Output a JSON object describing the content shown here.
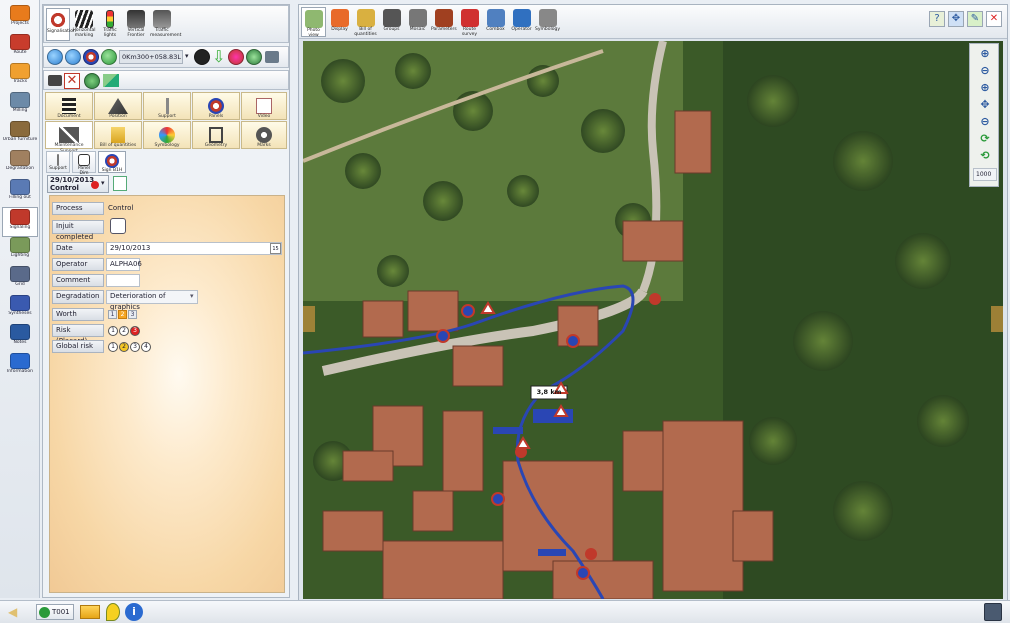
{
  "leftnav": {
    "items": [
      {
        "label": "Projects",
        "icon": "projects-icon",
        "color": "#e87b1c"
      },
      {
        "label": "Route",
        "icon": "route-icon",
        "color": "#c83c2c"
      },
      {
        "label": "Tracks",
        "icon": "tracks-icon",
        "color": "#f0a030"
      },
      {
        "label": "Milling",
        "icon": "milling-icon",
        "color": "#6c8aa8"
      },
      {
        "label": "Urban furniture",
        "icon": "urban-furniture-icon",
        "color": "#8a6a3c"
      },
      {
        "label": "Degradation",
        "icon": "degradation-icon",
        "color": "#a08060"
      },
      {
        "label": "Filling out",
        "icon": "filling-out-icon",
        "color": "#5a7ab4"
      },
      {
        "label": "Signaling",
        "icon": "signaling-icon",
        "color": "#c0392b"
      },
      {
        "label": "Lighting",
        "icon": "lighting-icon",
        "color": "#7a9a5a"
      },
      {
        "label": "Grid",
        "icon": "grid-icon",
        "color": "#5a6a8a"
      },
      {
        "label": "Syntheses",
        "icon": "syntheses-icon",
        "color": "#3a5ab0"
      },
      {
        "label": "Notes",
        "icon": "notes-icon",
        "color": "#2a5aa0"
      },
      {
        "label": "Information",
        "icon": "information-icon",
        "color": "#2a6ad0"
      }
    ]
  },
  "panel": {
    "top_tabs": [
      {
        "label": "Signalisation",
        "color": "#c0392b"
      },
      {
        "label": "Horizontal marking",
        "color": "#333333"
      },
      {
        "label": "Traffic lights",
        "color": "#e0b020"
      },
      {
        "label": "Vertical Frontier",
        "color": "#444444"
      },
      {
        "label": "Traffic measurement",
        "color": "#666666"
      }
    ],
    "pr_value": "0Km300+058.83L",
    "big_buttons_row1": [
      {
        "label": "Document"
      },
      {
        "label": "Position"
      },
      {
        "label": "Support"
      },
      {
        "label": "Panels"
      },
      {
        "label": "Video"
      }
    ],
    "big_buttons_row2": [
      {
        "label": "Maintenance Support"
      },
      {
        "label": "Bill of quantities"
      },
      {
        "label": "Symbology"
      },
      {
        "label": "Geometry"
      },
      {
        "label": "Marks"
      }
    ],
    "small_tabs": [
      {
        "label": "Support"
      },
      {
        "label": "Panel Dim"
      },
      {
        "label": "Sign B1H"
      }
    ],
    "date_selector": "29/10/2013",
    "date_selector_sub": "Control"
  },
  "form": {
    "rows": [
      {
        "label": "Process",
        "value": "Control"
      },
      {
        "label": "Injuit completed",
        "value": ""
      },
      {
        "label": "Date",
        "value": "29/10/2013"
      },
      {
        "label": "Operator",
        "value": "ALPHA06"
      },
      {
        "label": "Comment",
        "value": ""
      },
      {
        "label": "Degradation",
        "value": "Deterioration of graphics"
      },
      {
        "label": "Worth",
        "value": ""
      },
      {
        "label": "Risk (Placard)",
        "value": ""
      },
      {
        "label": "Global risk",
        "value": ""
      }
    ],
    "worth_options": [
      "1",
      "2",
      "3"
    ],
    "worth_selected": "2",
    "risk_options": [
      "1",
      "2",
      "3"
    ],
    "risk_selected": "3",
    "global_risk_options": [
      "1",
      "2",
      "3",
      "4"
    ],
    "global_risk_selected": "2"
  },
  "map_toolbar": {
    "buttons": [
      {
        "label": "Photo view"
      },
      {
        "label": "Display"
      },
      {
        "label": "Bill of quantities"
      },
      {
        "label": "Groups"
      },
      {
        "label": "Mosaic"
      },
      {
        "label": "Parameters"
      },
      {
        "label": "Route survey"
      },
      {
        "label": "Combox"
      },
      {
        "label": "Operator"
      },
      {
        "label": "Symbology"
      }
    ]
  },
  "map": {
    "distance_sign": "3,8 km",
    "scale_value": "1000"
  },
  "footer": {
    "selector": "T001"
  },
  "colors": {
    "road": "#2a46b4",
    "accent": "#2c5aa0",
    "panel_bg": "#f7d7a6"
  }
}
